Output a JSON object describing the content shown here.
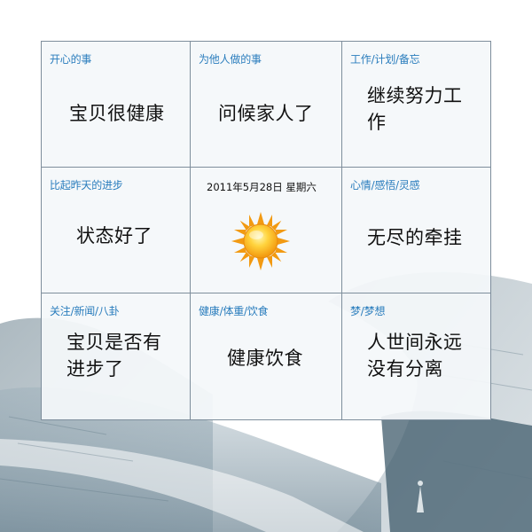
{
  "cells": [
    {
      "category": "开心的事",
      "content": "宝贝很健康"
    },
    {
      "category": "为他人做的事",
      "content": "问候家人了"
    },
    {
      "category": "工作/计划/备忘",
      "content_lines": [
        "继续努力工",
        "作"
      ]
    },
    {
      "category": "比起昨天的进步",
      "content": "状态好了"
    },
    {
      "date": "2011年5月28日 星期六",
      "icon": "sun-icon"
    },
    {
      "category": "心情/感悟/灵感",
      "content": "无尽的牵挂"
    },
    {
      "category": "关注/新闻/八卦",
      "content_lines": [
        "宝贝是否有",
        "进步了"
      ]
    },
    {
      "category": "健康/体重/饮食",
      "content": "健康饮食"
    },
    {
      "category": "梦/梦想",
      "content_lines": [
        "人世间永远",
        "没有分离"
      ]
    }
  ],
  "colors": {
    "category_text": "#2a7dbd",
    "cell_border": "#7e8e9c",
    "sun_core": "#f7b51a",
    "sun_rays": "#f29a12"
  }
}
